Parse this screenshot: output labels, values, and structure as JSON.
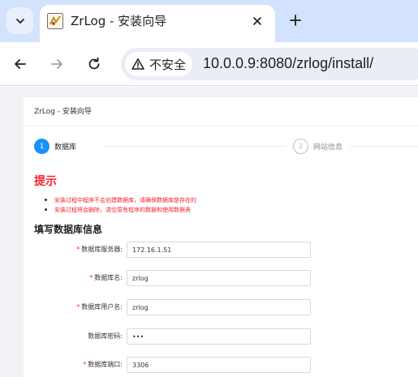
{
  "browser": {
    "tab_title": "ZrLog - 安装向导",
    "security_label": "不安全",
    "url": "10.0.0.9:8080/zrlog/install/"
  },
  "page": {
    "card_title": "ZrLog - 安装向导",
    "steps": [
      {
        "number": "1",
        "label": "数据库",
        "state": "active"
      },
      {
        "number": "2",
        "label": "网站信息",
        "state": "inactive"
      }
    ],
    "tip_title": "提示",
    "tips": [
      "安装过程中程序不会创建数据库，请确保数据库是存在的",
      "安装过程将会删除，清空原有程序的数据和使用数据表"
    ],
    "section_title": "填写数据库信息",
    "fields": [
      {
        "label": "数据库服务器:",
        "required": true,
        "value": "172.16.1.51",
        "type": "text"
      },
      {
        "label": "数据库名:",
        "required": true,
        "value": "zrlog",
        "type": "text"
      },
      {
        "label": "数据库用户名:",
        "required": true,
        "value": "zrlog",
        "type": "text"
      },
      {
        "label": "数据库密码:",
        "required": false,
        "value": "•••",
        "type": "password"
      },
      {
        "label": "数据库端口:",
        "required": true,
        "value": "3306",
        "type": "text"
      }
    ]
  },
  "colors": {
    "accent": "#1890ff",
    "warning": "#f5222d",
    "chrome_bg": "#d3e3fd"
  }
}
